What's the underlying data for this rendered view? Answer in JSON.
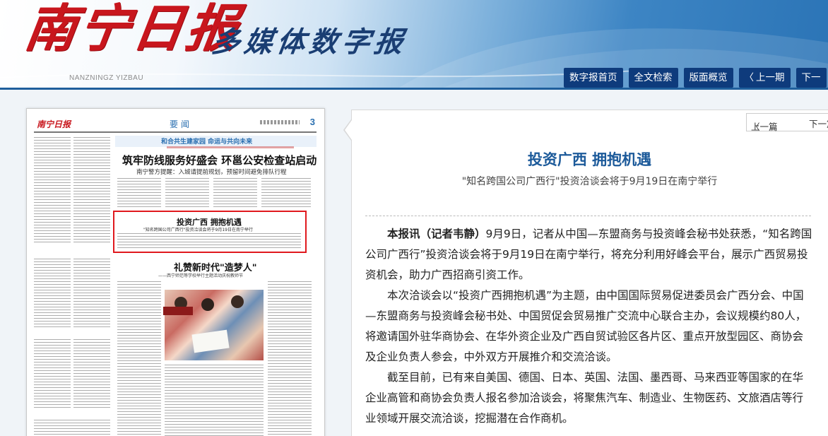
{
  "header": {
    "logo": "南宁日报",
    "logo_sub": "多媒体数字报",
    "pinyin": "NANZNINGZ YIZBAU"
  },
  "nav": {
    "home": "数字报首页",
    "search": "全文检索",
    "overview": "版面概览",
    "prev": "上一期",
    "next": "下一"
  },
  "paper": {
    "mini_logo": "南宁日报",
    "section": "要闻",
    "page_number": "3",
    "banner": "和合共生建家园  命运与共向未来",
    "headline": "筑牢防线服务好盛会  环邕公安检查站启动",
    "headline_sub": "南宁警方提醒：入城请提前规划，预留时间避免排队行程",
    "highlight_title": "投资广西  拥抱机遇",
    "highlight_sub": "\"知名跨国公司广西行\"投资洽谈会将于9月19日在南宁举行",
    "mid_title": "礼赞新时代\"造梦人\"",
    "mid_sub": "——西宁师范等学校举行主题活动庆祝教师节"
  },
  "pager": {
    "prev": "上一篇",
    "next": "下一篇"
  },
  "article": {
    "title": "投资广西 拥抱机遇",
    "subtitle": "\"知名跨国公司广西行\"投资洽谈会将于9月19日在南宁举行",
    "lead": "本报讯（记者韦静）",
    "p1": "9月9日，记者从中国—东盟商务与投资峰会秘书处获悉，“知名跨国公司广西行”投资洽谈会将于9月19日在南宁举行，将充分利用好峰会平台，展示广西贸易投资机会，助力广西招商引资工作。",
    "p2": "本次洽谈会以“投资广西拥抱机遇”为主题，由中国国际贸易促进委员会广西分会、中国—东盟商务与投资峰会秘书处、中国贸促会贸易推广交流中心联合主办，会议规模约80人，将邀请国外驻华商协会、在华外资企业及广西自贸试验区各片区、重点开放型园区、商协会及企业负责人参会，中外双方开展推介和交流洽谈。",
    "p3": "截至目前，已有来自美国、德国、日本、英国、法国、墨西哥、马来西亚等国家的在华企业高管和商协会负责人报名参加洽谈会，将聚焦汽车、制造业、生物医药、文旅酒店等行业领域开展交流洽谈，挖掘潜在合作商机。"
  },
  "colors": {
    "nav_bg": "#0e3b7c",
    "logo_red": "#c8161d",
    "title_blue": "#1c5a9a",
    "highlight_red": "#e0191e"
  }
}
